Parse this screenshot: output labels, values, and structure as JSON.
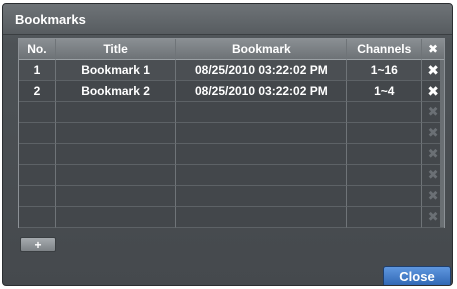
{
  "window": {
    "title": "Bookmarks"
  },
  "table": {
    "headers": {
      "no": "No.",
      "title": "Title",
      "bookmark": "Bookmark",
      "channels": "Channels",
      "delete": "✖"
    },
    "rows": [
      {
        "no": "1",
        "title": "Bookmark 1",
        "bookmark": "08/25/2010  03:22:02 PM",
        "channels": "1~16",
        "delete": "✖"
      },
      {
        "no": "2",
        "title": "Bookmark 2",
        "bookmark": "08/25/2010  03:22:02 PM",
        "channels": "1~4",
        "delete": "✖"
      },
      {
        "no": "",
        "title": "",
        "bookmark": "",
        "channels": "",
        "delete": "✖"
      },
      {
        "no": "",
        "title": "",
        "bookmark": "",
        "channels": "",
        "delete": "✖"
      },
      {
        "no": "",
        "title": "",
        "bookmark": "",
        "channels": "",
        "delete": "✖"
      },
      {
        "no": "",
        "title": "",
        "bookmark": "",
        "channels": "",
        "delete": "✖"
      },
      {
        "no": "",
        "title": "",
        "bookmark": "",
        "channels": "",
        "delete": "✖"
      },
      {
        "no": "",
        "title": "",
        "bookmark": "",
        "channels": "",
        "delete": "✖"
      }
    ]
  },
  "buttons": {
    "add": "+",
    "close": "Close"
  },
  "colors": {
    "accent": "#3f78c8"
  }
}
